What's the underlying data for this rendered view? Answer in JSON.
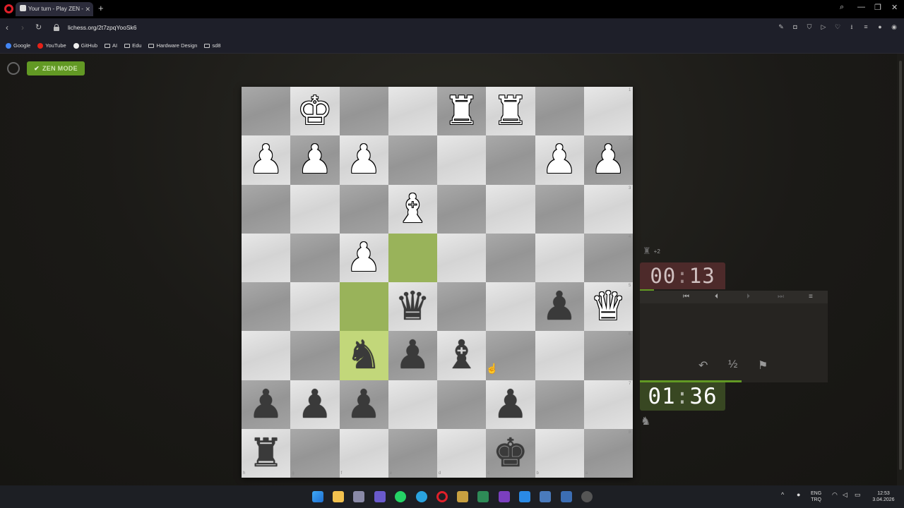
{
  "browser": {
    "tab_title": "Your turn - Play ZEN -",
    "url": "lichess.org/2t7zpqYooSk6",
    "bookmarks": [
      "Google",
      "YouTube",
      "GitHub",
      "AI",
      "Edu",
      "Hardware Design",
      "sd8"
    ]
  },
  "page": {
    "zen_label": "ZEN MODE"
  },
  "board": {
    "orientation": "black",
    "rank_labels": [
      "1",
      "2",
      "3",
      "4",
      "5",
      "6",
      "7",
      "8"
    ],
    "file_labels": [
      "h",
      "g",
      "f",
      "e",
      "d",
      "c",
      "b",
      "a"
    ],
    "highlights": [
      "f6",
      "f5",
      "e4"
    ],
    "pieces": [
      {
        "sq": "g1",
        "p": "K",
        "c": "w"
      },
      {
        "sq": "d1",
        "p": "R",
        "c": "w"
      },
      {
        "sq": "c1",
        "p": "R",
        "c": "w"
      },
      {
        "sq": "h2",
        "p": "P",
        "c": "w"
      },
      {
        "sq": "g2",
        "p": "P",
        "c": "w"
      },
      {
        "sq": "f2",
        "p": "P",
        "c": "w"
      },
      {
        "sq": "b2",
        "p": "P",
        "c": "w"
      },
      {
        "sq": "a2",
        "p": "P",
        "c": "w"
      },
      {
        "sq": "e3",
        "p": "B",
        "c": "w"
      },
      {
        "sq": "f4",
        "p": "P",
        "c": "w"
      },
      {
        "sq": "e5",
        "p": "Q",
        "c": "b"
      },
      {
        "sq": "b5",
        "p": "P",
        "c": "b"
      },
      {
        "sq": "a5",
        "p": "Q",
        "c": "w"
      },
      {
        "sq": "f6",
        "p": "N",
        "c": "b"
      },
      {
        "sq": "e6",
        "p": "P",
        "c": "b"
      },
      {
        "sq": "d6",
        "p": "B",
        "c": "b"
      },
      {
        "sq": "h7",
        "p": "P",
        "c": "b"
      },
      {
        "sq": "g7",
        "p": "P",
        "c": "b"
      },
      {
        "sq": "f7",
        "p": "P",
        "c": "b"
      },
      {
        "sq": "c7",
        "p": "P",
        "c": "b"
      },
      {
        "sq": "h8",
        "p": "R",
        "c": "b"
      },
      {
        "sq": "c8",
        "p": "K",
        "c": "b"
      }
    ]
  },
  "opponent": {
    "material_diff": "+2",
    "clock_min": "00",
    "clock_sec": "13"
  },
  "player": {
    "clock_min": "01",
    "clock_sec": "36"
  },
  "controls": {
    "first": "⏮",
    "prev": "⏴",
    "next": "⏵",
    "last": "⏭",
    "menu": "≡",
    "takeback": "↶",
    "draw": "½",
    "resign": "⚑"
  },
  "system": {
    "lang_top": "ENG",
    "lang_bot": "TRQ",
    "time": "12:53",
    "date": "3.04.2026"
  },
  "colors": {
    "accent_green": "#629924",
    "clock_low": "#4d2a2a",
    "clock_active": "#384722"
  }
}
